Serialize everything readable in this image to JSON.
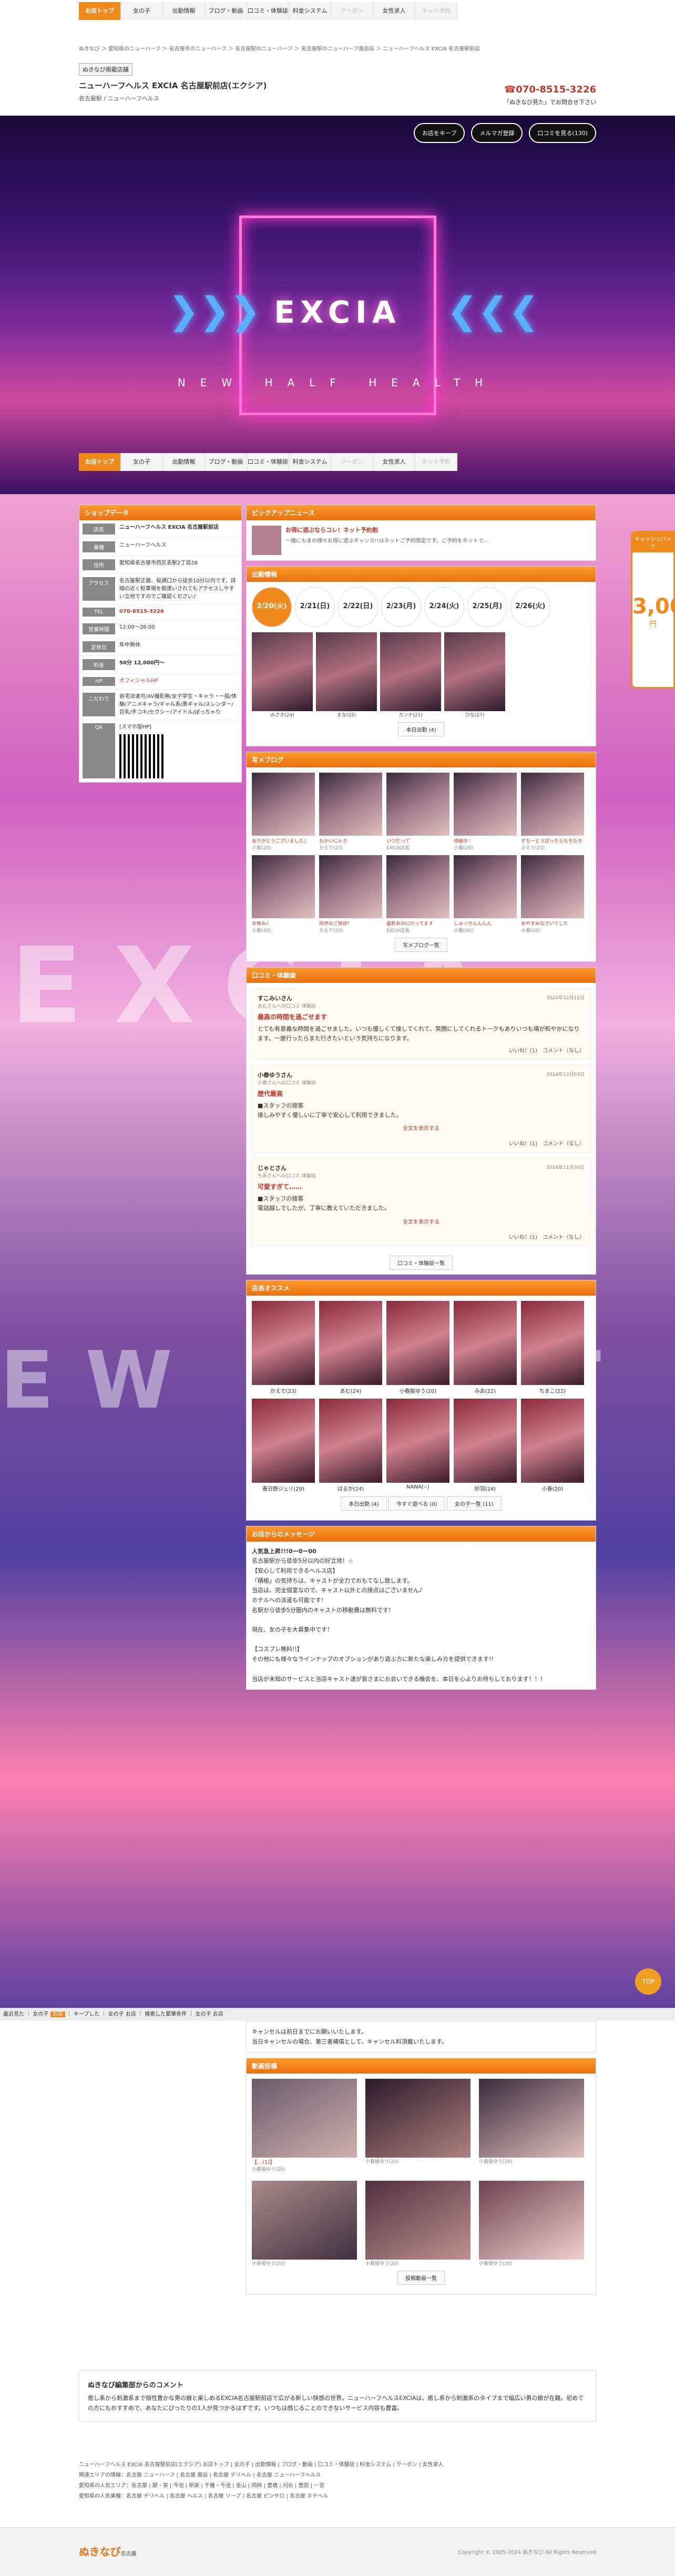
{
  "site": {
    "logo": "ぬきなび",
    "logo_sub": "名古屋"
  },
  "nav": [
    "お店トップ",
    "女の子",
    "出勤情報",
    "ブログ・動画",
    "口コミ・体験談",
    "料金システム",
    "クーポン",
    "女性求人",
    "ネット予約"
  ],
  "breadcrumb": "ぬきなび ＞ 愛知県のニューハーフ ＞ 名古屋市のニューハーフ ＞ 名古屋駅のニューハーフ ＞ 名古屋駅のニューハーフ風俗店 ＞ ニューハーフヘルス EXCIA 名古屋駅前店",
  "shop": {
    "badge": "ぬきなび掲載店舗",
    "title": "ニューハーフヘルス EXCIA 名古屋駅前店(エクシア)",
    "sub": "名古屋駅 / ニューハーフヘルス",
    "tel": "070-8515-3226",
    "tel_note": "「ぬきなび見た」でお問合せ下さい"
  },
  "hero": {
    "keep": "お店をキープ",
    "mail": "メルマガ登録",
    "review_btn": "口コミを見る(130)",
    "logo": "EXCIA",
    "tagline": "NEW HALF HEALTH",
    "arrows_l": "❯❯❯",
    "arrows_r": "❮❮❮"
  },
  "side": {
    "section": "ショップデータ",
    "rows": [
      {
        "k": "店名",
        "v": "ニューハーフヘルス EXCIA 名古屋駅前店"
      },
      {
        "k": "業種",
        "v": "ニューハーフヘルス"
      },
      {
        "k": "住所",
        "v": "愛知県名古屋市西区名駅2丁目26"
      },
      {
        "k": "アクセス",
        "v": "名古屋駅正面、桜通口から徒歩10分以内です。詳細の近く駐車場を勘違いされてもアクセスしやすい立地ですのでご確認ください♪"
      },
      {
        "k": "TEL",
        "v": "070-8515-3226"
      },
      {
        "k": "営業時間",
        "v": "12:00〜26:00"
      },
      {
        "k": "定休日",
        "v": "年中無休"
      },
      {
        "k": "料金",
        "v": "50分 12,000円〜"
      },
      {
        "k": "HP",
        "v": "オフィシャルHP"
      },
      {
        "k": "こだわり",
        "v": "自宅派遣可/AV撮影無/女子学生・キャラ・一般/体験/アニメキャラ/ギャル系/黒ギャル/スレンダー/巨乳/手コキ/セクシー/アイドル/ぽっちゃり"
      },
      {
        "k": "QR",
        "v": "[スマホ版HP]"
      }
    ]
  },
  "pickup": {
    "section": "ピックアップニュース",
    "text": "お得に遊ぶならコレ！ネット予約割",
    "sub": "一緒にもまの様々お得に遊ぶチャンス!!はネットご予約限定です。ご予約をネットで…"
  },
  "schedule": {
    "section": "出勤情報",
    "days": [
      "2/20(火)",
      "2/21(日)",
      "2/22(日)",
      "2/23(月)",
      "2/24(火)",
      "2/25(月)",
      "2/26(火)"
    ],
    "girls": [
      "みさき(24)",
      "まな(25)",
      "カンナ(21)",
      "ひな(27)"
    ],
    "btn": "本日出勤 (4)"
  },
  "blog_sec": {
    "section": "写メブログ",
    "items": [
      {
        "t": "ありがとうございました♪",
        "m": "小春(20)"
      },
      {
        "t": "おかいにゃき",
        "m": "かえで(23)"
      },
      {
        "t": "いつだって",
        "m": "EXCIA店長"
      },
      {
        "t": "待機中♡",
        "m": "小春(20)"
      },
      {
        "t": "ずちーとうぽったらもちもち",
        "m": "かえで(23)"
      },
      {
        "t": "お休み♪",
        "m": "小春(20)"
      },
      {
        "t": "同伴のご挨拶！",
        "m": "かえで(23)"
      },
      {
        "t": "最新あのに行ってます",
        "m": "EXCIA店長"
      },
      {
        "t": "しゅっきんんんん",
        "m": "小春(20)"
      },
      {
        "t": "おやすみなさいでした",
        "m": "小春(20)"
      }
    ],
    "btn": "写メブログ一覧"
  },
  "reviews": {
    "section": "口コミ・体験談",
    "items": [
      {
        "user": "すこみいさん",
        "to": "あむさんへの口コミ 体験談",
        "date": "2024年12月12日",
        "h": "最高の時間を過ごせます",
        "b": "とても有意義な時間を過ごせました。いつも優しくて接してくれて、笑顔にしてくれるトークもありいつも場が和やかになります。一度行ったらまた行きたいという気持ちになります。",
        "f1": "いいね！(1)",
        "f2": "コメント（なし）"
      },
      {
        "user": "小春ゆうさん",
        "to": "小春さんへの口コミ 体験談",
        "date": "2024年12月03日",
        "h": "歴代最高",
        "b": "■スタッフの接客\n接しみやすく優しいに丁寧で安心して利用できました。",
        "f1": "いいね！(1)",
        "f2": "コメント（なし）"
      },
      {
        "user": "じゃとさん",
        "to": "ちあさんへの口コミ 体験談",
        "date": "2024年11月30日",
        "h": "可愛すぎて……",
        "b": "■スタッフの接客\n電話越しでしたが、丁寧に教えていただきました。",
        "f1": "いいね！(1)",
        "f2": "コメント（なし）"
      }
    ],
    "more": "全文を表示する",
    "btn": "口コミ・体験談一覧"
  },
  "recommend": {
    "section": "店長オススメ",
    "girls": [
      "かえで(23)",
      "あむ(24)",
      "小春姫ゆう(20)",
      "みあ(22)",
      "ちまこ(22)",
      "春日野ジュリ(29)",
      "はるか(24)",
      "NANA(--)",
      "紗羽(24)",
      "小春(20)"
    ],
    "b1": "本日出勤 (4)",
    "b2": "今すぐ遊べる (0)",
    "b3": "女の子一覧 (11)"
  },
  "message": {
    "section": "お店からのメッセージ",
    "lines": [
      "人気急上昇!!!0ー0ー00",
      "名古屋駅から徒歩5分以内の好立地！☆",
      "【安心して利用できるヘルス店】",
      "「積極」の気持ちは、キャストが全力でおもてなし致します。",
      "当店は、完全個室なので、キャスト以外との接点はございません♪",
      "ホテルへの派遣も可能です!",
      "名駅から徒歩5分圏内のキャストの移動費は無料です!",
      "",
      "現在、女の子を大募集中です！",
      "",
      "【コスプレ無料!!】",
      "その他にも様々なラインナップのオプションがあり遊ぶ方に新たな楽しみ方を提供できます!!",
      "",
      "当店が未知のサービスと当店キャスト達が皆さまにお会いできる機会を、本日を心よりお待ちしております！！！"
    ]
  },
  "bottom": {
    "items": [
      "最近見た",
      "女の子",
      "お店",
      "キープした",
      "女の子",
      "お店",
      "検索した繁華条件",
      "女の子",
      "お店"
    ]
  },
  "lower": {
    "cancel": "キャンセルは前日までにお願いいたします。\n当日キャンセルの場合、第三者補償として、キャンセル料頂戴いたします。",
    "section": "動画投稿",
    "items": [
      {
        "t": "【…(1)】",
        "m": "小春姫ゆう(20)"
      },
      {
        "t": "",
        "m": "小春姫ゆう(20)"
      },
      {
        "t": "",
        "m": "小春姫ゆう(20)"
      },
      {
        "t": "",
        "m": "小春姫ゆう(20)"
      },
      {
        "t": "",
        "m": "小春姫ゆう(20)"
      },
      {
        "t": "",
        "m": "小春姫ゆう(20)"
      }
    ],
    "btn": "投稿動画一覧"
  },
  "editor": {
    "title": "ぬきなび編集部からのコメント",
    "body": "癒し系から刺激系まで個性豊かな男の娘と楽しめるEXCIA名古屋駅前店で広がる新しい快感の世界。ニューハーフヘルスEXCIAは、癒し系から刺激系のタイプまで幅広い男の娘が在籍。初めての方にもおすすめで、あなたにぴったりの1人が見つかるはずです。いつもは感じることのできないサービス内容も豊富。"
  },
  "footer": {
    "l1": "ニューハーフヘルス EXCIA 名古屋駅前店(エクシア) お店トップ | 女の子 | 出勤情報 | ブログ・動画 | 口コミ・体験談 | 料金システム | クーポン | 女性求人",
    "l2": "関連エリアの情報：名古屋 ニューハーフ | 名古屋 風俗 | 名古屋 デリヘル | 名古屋 ニューハーフヘルス",
    "l3": "愛知県の人気エリア：名古屋 | 錦・栄 | 今池 | 新栄 | 千種・今池 | 金山 | 岡崎 | 豊橋 | 刈谷 | 豊田 | 一宮",
    "l4": "愛知県の人気業種：名古屋 デリヘル | 名古屋 ヘルス | 名古屋 ソープ | 名古屋 ピンサロ | 名古屋 ホテヘル",
    "copy": "Copyright © 2005-2024 ぬきなび All Rights Reserved"
  },
  "float": {
    "top": "キャッシュバック",
    "n": "3,000",
    "sub": "円"
  },
  "pagetop": "TOP"
}
